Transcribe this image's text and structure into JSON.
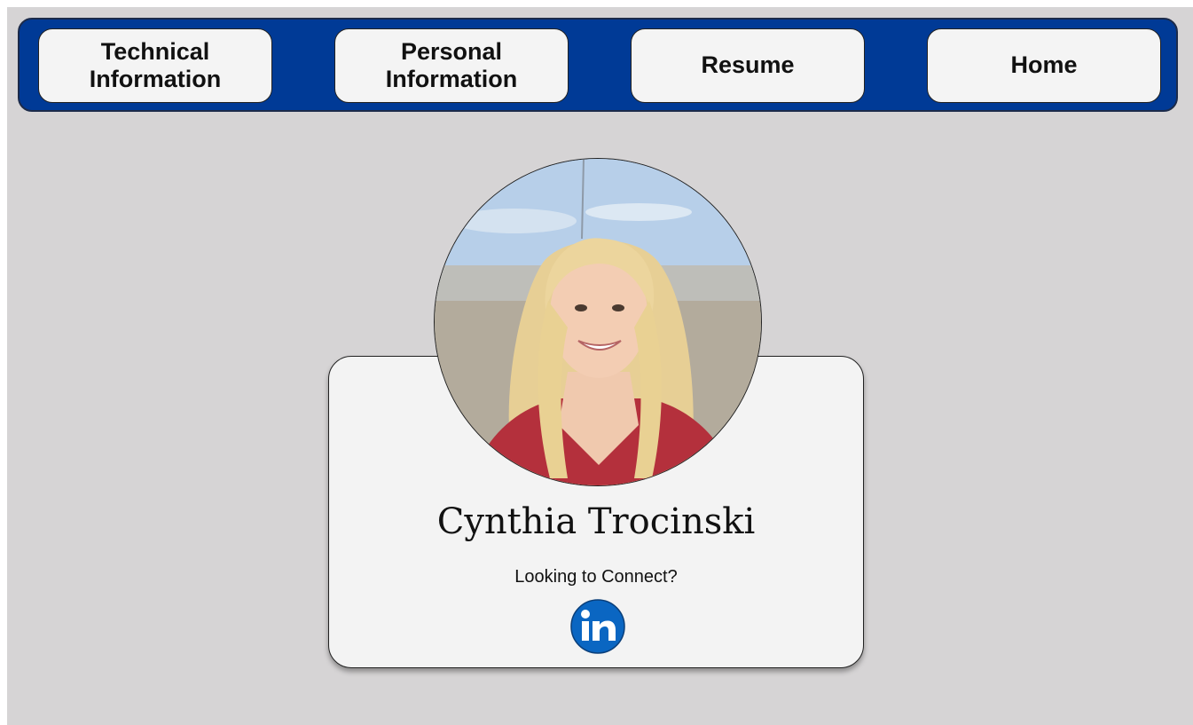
{
  "nav": {
    "items": [
      {
        "label": "Technical\nInformation"
      },
      {
        "label": "Personal\nInformation"
      },
      {
        "label": "Resume"
      },
      {
        "label": "Home"
      }
    ]
  },
  "profile": {
    "name": "Cynthia Trocinski",
    "connect_text": "Looking to Connect?",
    "social_icon": "linkedin-icon"
  },
  "colors": {
    "nav_background": "#003a96",
    "page_background": "#d6d4d5",
    "linkedin_blue": "#0a66c2"
  }
}
